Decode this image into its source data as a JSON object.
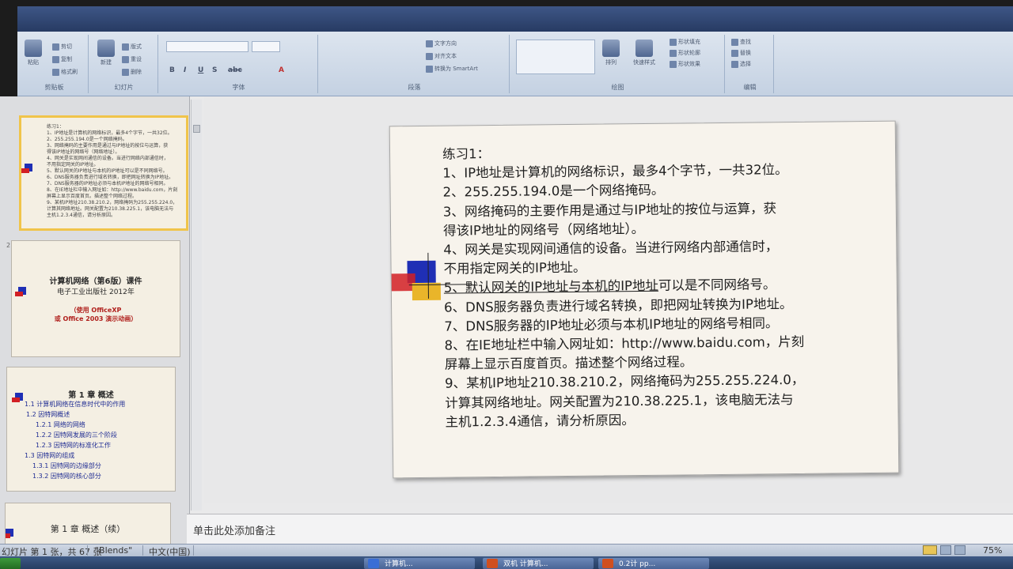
{
  "ribbon": {
    "groups": [
      "剪贴板",
      "幻灯片",
      "字体",
      "段落",
      "绘图",
      "编辑"
    ],
    "font_format_buttons": [
      "B",
      "I",
      "U",
      "S",
      "abc",
      "A"
    ],
    "clipboard_items": [
      "剪切",
      "复制",
      "格式刷"
    ],
    "slides_items": [
      "新建",
      "版式",
      "重设",
      "删除"
    ],
    "paragraph_items": [
      "文字方向",
      "对齐文本",
      "转换为 SmartArt"
    ],
    "drawing_items": [
      "排列",
      "快速样式",
      "形状填充",
      "形状轮廓",
      "形状效果"
    ],
    "editing_items": [
      "查找",
      "替换",
      "选择"
    ],
    "paste_label": "粘贴"
  },
  "thumbnails": {
    "slide1_lines": [
      "练习1：",
      "1、IP地址是计算机的网络标识，最多4个字节，一共32位。",
      "2、255.255.194.0是一个网络掩码。",
      "3、网络掩码的主要作用是通过与IP地址的按位与运算，获",
      "得该IP地址的网络号（网络地址）。",
      "4、网关是实现网间通信的设备。当进行网络内部通信时，",
      "不用指定网关的IP地址。",
      "5、默认网关的IP地址与本机的IP地址可以是不同网络号。",
      "6、DNS服务器负责进行域名转换，即把网址转换为IP地址。",
      "7、DNS服务器的IP地址必须与本机IP地址的网络号相同。",
      "8、在IE地址栏中输入网址如：http://www.baidu.com，片刻",
      "屏幕上显示百度首页。描述整个网络过程。",
      "9、某机IP地址210.38.210.2，网络掩码为255.255.224.0，",
      "计算其网络地址。网关配置为210.38.225.1，该电脑无法与",
      "主机1.2.3.4通信，请分析原因。"
    ],
    "slide2_number": "2",
    "slide2_title": "计算机网络（第6版）课件",
    "slide2_sub": "电子工业出版社 2012年",
    "slide2_red1": "（使用 OfficeXP",
    "slide2_red2": "或 Office 2003 演示动画）",
    "slide3_title": "第 1 章   概述",
    "slide3_toc": [
      "1.1  计算机网络在信息时代中的作用",
      "1.2  因特网概述",
      "1.2.1  网络的网络",
      "1.2.2  因特网发展的三个阶段",
      "1.2.3  因特网的标准化工作",
      "1.3  因特网的组成",
      "1.3.1  因特网的边缘部分",
      "1.3.2  因特网的核心部分"
    ],
    "slide4_title": "第 1 章   概述（续）"
  },
  "slide": {
    "lines": [
      "练习1：",
      "1、IP地址是计算机的网络标识，最多4个字节，一共32位。",
      "2、255.255.194.0是一个网络掩码。",
      "3、网络掩码的主要作用是通过与IP地址的按位与运算，获",
      "得该IP地址的网络号（网络地址）。",
      "4、网关是实现网间通信的设备。当进行网络内部通信时，",
      "不用指定网关的IP地址。",
      "5、默认网关的IP地址与本机的IP地址",
      "可以是不同网络号。",
      "6、DNS服务器负责进行域名转换，即把网址转换为IP地址。",
      "7、DNS服务器的IP地址必须与本机IP地址的网络号相同。",
      "8、在IE地址栏中输入网址如：http://www.baidu.com，片刻",
      "屏幕上显示百度首页。描述整个网络过程。",
      "9、某机IP地址210.38.210.2，网络掩码为255.255.224.0，",
      "计算其网络地址。网关配置为210.38.225.1，该电脑无法与",
      "主机1.2.3.4通信，请分析原因。"
    ]
  },
  "notes": {
    "placeholder": "单击此处添加备注"
  },
  "status": {
    "slide_counter": "幻灯片 第 1 张，共 67 张",
    "theme": "\"Blends\"",
    "language": "中文(中国)",
    "zoom": "75%"
  },
  "taskbar": {
    "task1": "计算机...",
    "task2": "双机 计算机...",
    "task3": "0.2计 pp..."
  },
  "colors": {
    "accent_blue": "#1f2fb5",
    "accent_red": "#d21f24",
    "accent_yellow": "#e9b52a"
  }
}
